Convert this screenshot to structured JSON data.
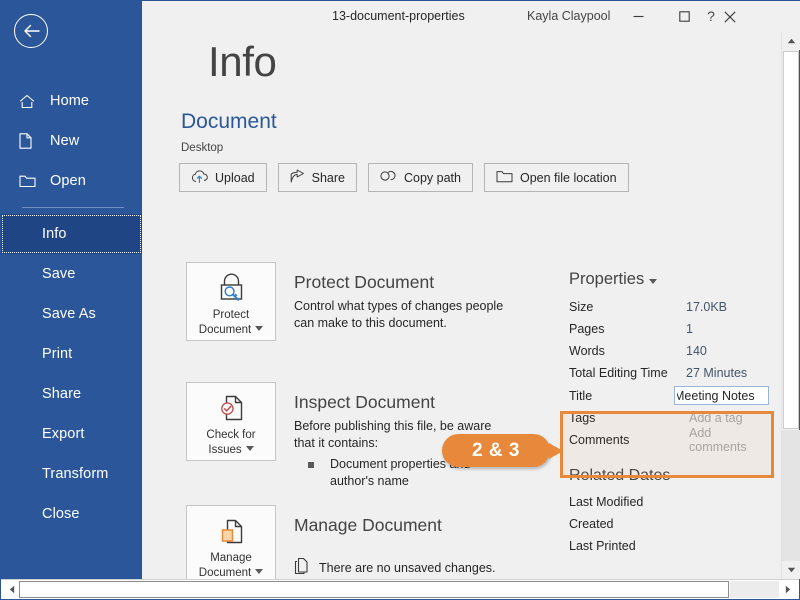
{
  "titlebar": {
    "document_title": "13-document-properties",
    "user_name": "Kayla Claypool",
    "help_label": "?",
    "minimize_label": "minimize-icon",
    "maximize_label": "maximize-icon",
    "close_label": "close-icon"
  },
  "sidebar": {
    "back_label": "back-arrow-icon",
    "items": [
      {
        "label": "Home",
        "icon": "home-icon",
        "selected": false
      },
      {
        "label": "New",
        "icon": "new-document-icon",
        "selected": false
      },
      {
        "label": "Open",
        "icon": "open-folder-icon",
        "selected": false
      },
      {
        "label": "Info",
        "icon": "",
        "selected": true
      },
      {
        "label": "Save",
        "icon": "",
        "selected": false
      },
      {
        "label": "Save As",
        "icon": "",
        "selected": false
      },
      {
        "label": "Print",
        "icon": "",
        "selected": false
      },
      {
        "label": "Share",
        "icon": "",
        "selected": false
      },
      {
        "label": "Export",
        "icon": "",
        "selected": false
      },
      {
        "label": "Transform",
        "icon": "",
        "selected": false
      },
      {
        "label": "Close",
        "icon": "",
        "selected": false
      }
    ]
  },
  "main": {
    "page_title": "Info",
    "document_name": "Document",
    "document_path": "Desktop",
    "toolbar_buttons": [
      {
        "label": "Upload",
        "icon": "cloud-upload-icon"
      },
      {
        "label": "Share",
        "icon": "share-arrow-icon"
      },
      {
        "label": "Copy path",
        "icon": "link-icon"
      },
      {
        "label": "Open file location",
        "icon": "folder-open-icon"
      }
    ],
    "sections": [
      {
        "card_label_line1": "Protect",
        "card_label_line2": "Document",
        "card_icon": "lock-key-icon",
        "heading": "Protect Document",
        "body_line1": "Control what types of changes people",
        "body_line2": "can make to this document.",
        "bullets": []
      },
      {
        "card_label_line1": "Check for",
        "card_label_line2": "Issues",
        "card_icon": "document-check-icon",
        "heading": "Inspect Document",
        "body_line1": "Before publishing this file, be aware",
        "body_line2": "that it contains:",
        "bullets": [
          "Document properties and author's name"
        ]
      },
      {
        "card_label_line1": "Manage",
        "card_label_line2": "Document",
        "card_icon": "document-versions-icon",
        "heading": "Manage Document",
        "status_icon": "document-copy-icon",
        "status_text": "There are no unsaved changes.",
        "bullets": []
      }
    ]
  },
  "properties": {
    "heading": "Properties",
    "rows": [
      {
        "key": "Size",
        "value": "17.0KB",
        "editable": false
      },
      {
        "key": "Pages",
        "value": "1",
        "editable": false
      },
      {
        "key": "Words",
        "value": "140",
        "editable": false
      },
      {
        "key": "Total Editing Time",
        "value": "27 Minutes",
        "editable": false
      },
      {
        "key": "Title",
        "value": "Meeting Notes",
        "editable": true,
        "focused": true
      },
      {
        "key": "Tags",
        "value": "Add a tag",
        "editable": true,
        "focused": false
      },
      {
        "key": "Comments",
        "value": "Add comments",
        "editable": true,
        "focused": false
      }
    ]
  },
  "related_dates": {
    "heading": "Related Dates",
    "rows": [
      {
        "key": "Last Modified",
        "value": ""
      },
      {
        "key": "Created",
        "value": ""
      },
      {
        "key": "Last Printed",
        "value": ""
      }
    ]
  },
  "annotation": {
    "callout_label": "2 & 3",
    "highlight_color": "#E8883A"
  },
  "colors": {
    "sidebar_blue": "#2B579A",
    "sidebar_selected": "#1F4585",
    "accent_orange": "#E8883A",
    "value_text": "#44546A",
    "doc_title_blue": "#2B579A"
  }
}
